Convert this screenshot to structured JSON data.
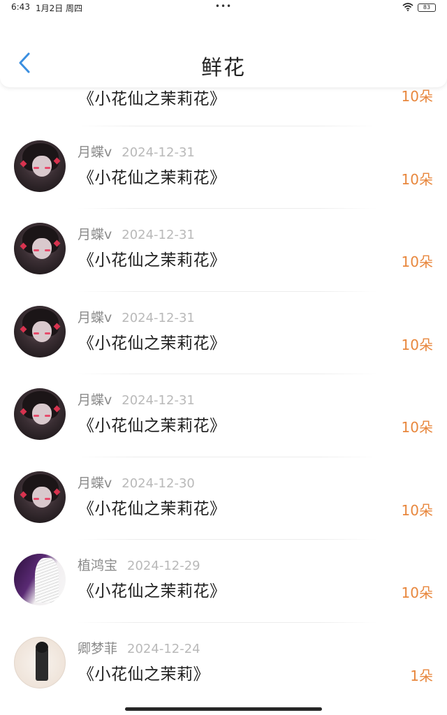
{
  "status_bar": {
    "time": "6:43",
    "date": "1月2日 周四",
    "dots": "•••",
    "battery": "83",
    "wifi_icon": "wifi-icon"
  },
  "header": {
    "title": "鲜花",
    "back_icon": "chevron-left-icon"
  },
  "colors": {
    "accent_orange": "#e8873d",
    "back_blue": "#3b8fe0",
    "name_gray": "#8a8a8a",
    "date_gray": "#b9b9b9"
  },
  "gifts": [
    {
      "name": "",
      "date": "",
      "gift": "《小花仙之茉莉花》",
      "amount": "10朵"
    },
    {
      "name": "月蝶v",
      "date": "2024-12-31",
      "gift": "《小花仙之茉莉花》",
      "amount": "10朵"
    },
    {
      "name": "月蝶v",
      "date": "2024-12-31",
      "gift": "《小花仙之茉莉花》",
      "amount": "10朵"
    },
    {
      "name": "月蝶v",
      "date": "2024-12-31",
      "gift": "《小花仙之茉莉花》",
      "amount": "10朵"
    },
    {
      "name": "月蝶v",
      "date": "2024-12-31",
      "gift": "《小花仙之茉莉花》",
      "amount": "10朵"
    },
    {
      "name": "月蝶v",
      "date": "2024-12-30",
      "gift": "《小花仙之茉莉花》",
      "amount": "10朵"
    },
    {
      "name": "植鸿宝",
      "date": "2024-12-29",
      "gift": "《小花仙之茉莉花》",
      "amount": "10朵"
    },
    {
      "name": "卿梦菲",
      "date": "2024-12-24",
      "gift": "《小花仙之茉莉》",
      "amount": "1朵"
    }
  ]
}
